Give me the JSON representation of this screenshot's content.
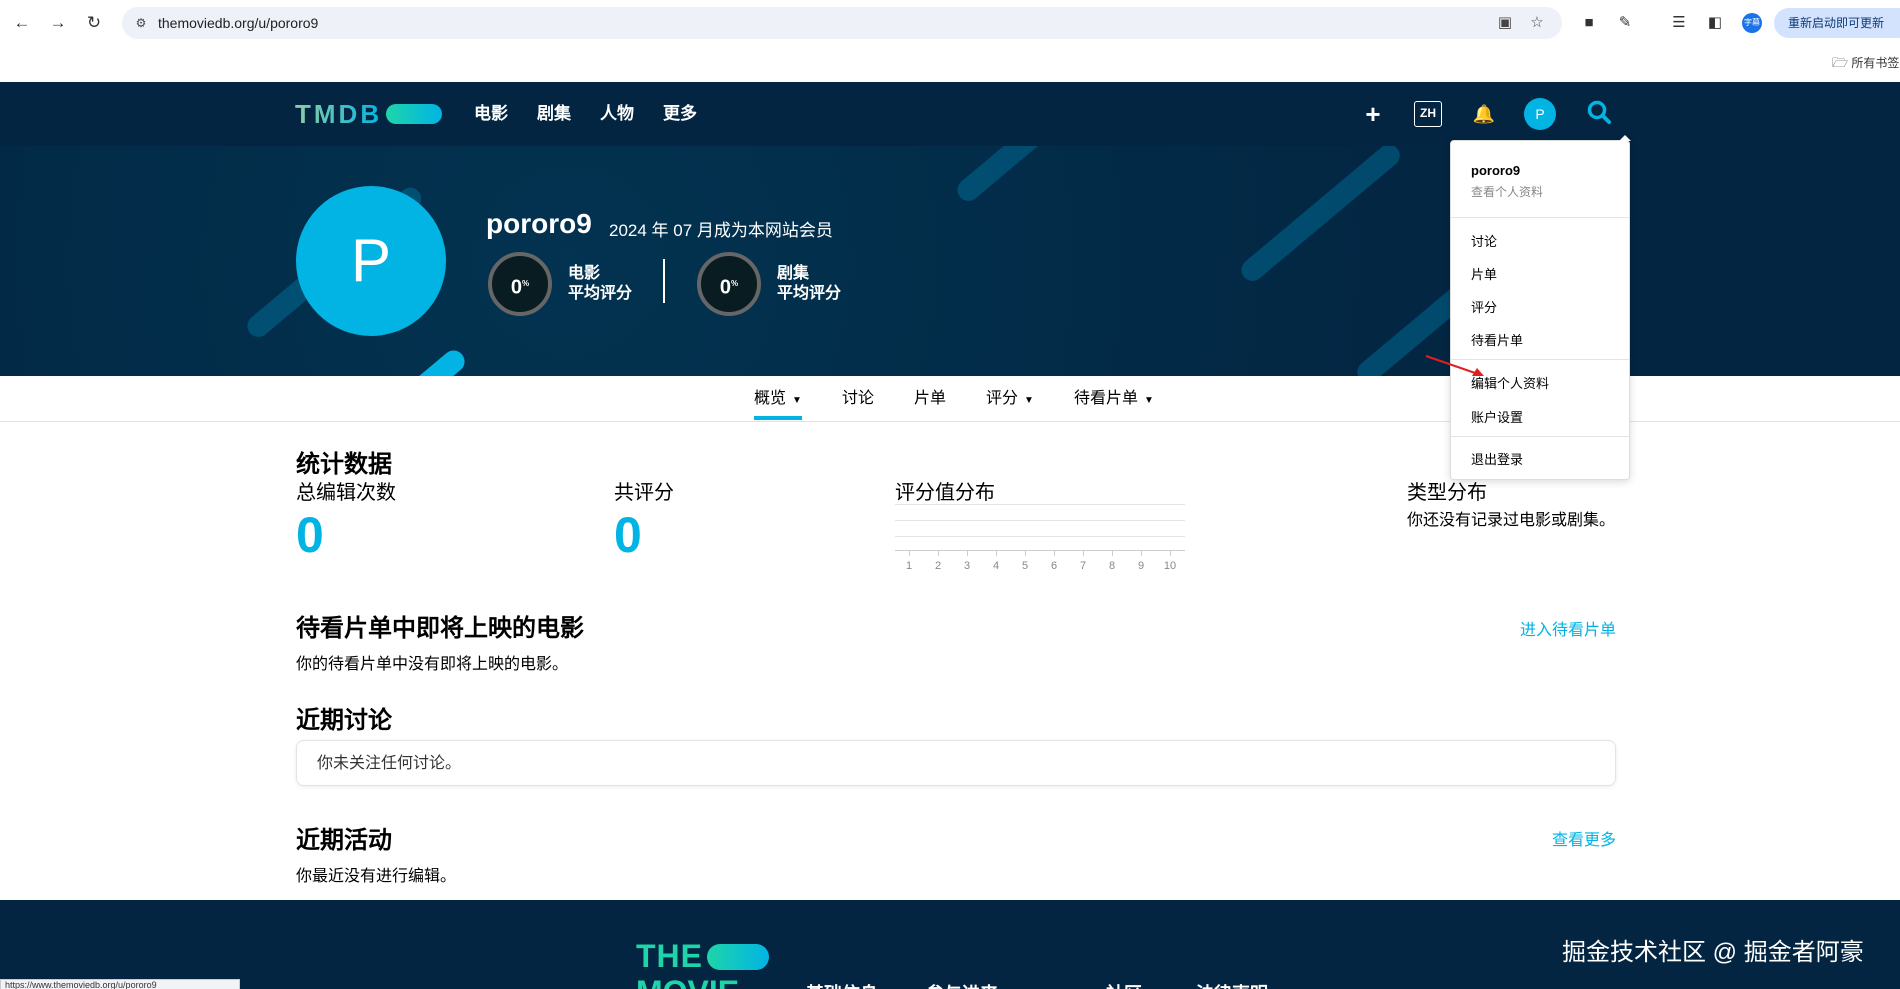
{
  "browser": {
    "url": "themoviedb.org/u/pororo9",
    "update_label": "重新启动即可更新",
    "profile_label": "字幕",
    "bookmarks_label": "所有书签",
    "status_url": "https://www.themoviedb.org/u/pororo9"
  },
  "header": {
    "logo": "TMDB",
    "nav": [
      "电影",
      "剧集",
      "人物",
      "更多"
    ],
    "lang": "ZH",
    "avatar_letter": "P"
  },
  "profile": {
    "avatar_letter": "P",
    "username": "pororo9",
    "member_since": "2024 年 07 月成为本网站会员",
    "movie_score": "0",
    "movie_label_1": "电影",
    "movie_label_2": "平均评分",
    "tv_score": "0",
    "tv_label_1": "剧集",
    "tv_label_2": "平均评分",
    "percent": "%"
  },
  "tabs": [
    {
      "label": "概览",
      "caret": true,
      "active": true
    },
    {
      "label": "讨论",
      "caret": false
    },
    {
      "label": "片单",
      "caret": false
    },
    {
      "label": "评分",
      "caret": true
    },
    {
      "label": "待看片单",
      "caret": true
    }
  ],
  "stats": {
    "title": "统计数据",
    "total_edits_label": "总编辑次数",
    "total_edits": "0",
    "total_ratings_label": "共评分",
    "total_ratings": "0",
    "distribution_label": "评分值分布",
    "distribution_ticks": [
      "1",
      "2",
      "3",
      "4",
      "5",
      "6",
      "7",
      "8",
      "9",
      "10"
    ],
    "genre_label": "类型分布",
    "genre_empty": "你还没有记录过电影或剧集。"
  },
  "upcoming": {
    "title": "待看片单中即将上映的电影",
    "empty": "你的待看片单中没有即将上映的电影。",
    "link": "进入待看片单"
  },
  "discussions": {
    "title": "近期讨论",
    "empty": "你未关注任何讨论。"
  },
  "activity": {
    "title": "近期活动",
    "empty": "你最近没有进行编辑。",
    "link": "查看更多"
  },
  "dropdown": {
    "username": "pororo9",
    "view_profile": "查看个人资料",
    "items_1": [
      "讨论",
      "片单",
      "评分",
      "待看片单"
    ],
    "items_2": [
      "编辑个人资料",
      "账户设置"
    ],
    "logout": "退出登录"
  },
  "footer": {
    "logo_1": "THE",
    "logo_2": "MOVIE",
    "columns": [
      "基础信息",
      "参与进来",
      "社区",
      "法律声明"
    ],
    "watermark": "掘金技术社区 @ 掘金者阿豪"
  },
  "colors": {
    "navy": "#032541",
    "accent": "#01b4e4",
    "green": "#1ed5a9"
  }
}
